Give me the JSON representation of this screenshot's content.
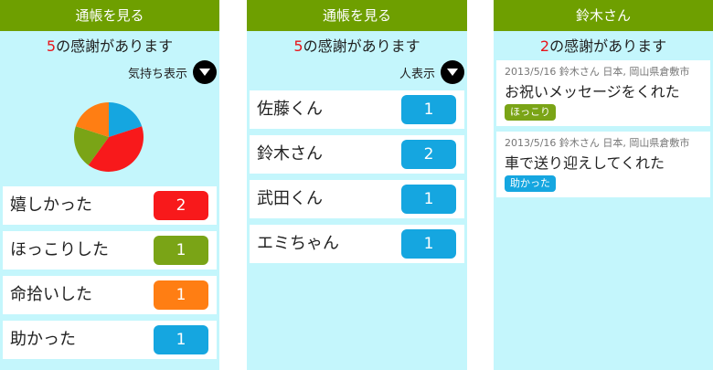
{
  "panel1": {
    "header": "通帳を見る",
    "count": "5",
    "count_suffix": "の感謝があります",
    "toggle_label": "気持ち表示",
    "pie": {
      "slices": [
        {
          "label": "嬉しかった",
          "value": 2,
          "color": "#f8191b"
        },
        {
          "label": "ほっこりした",
          "value": 1,
          "color": "#7aa416"
        },
        {
          "label": "命拾いした",
          "value": 1,
          "color": "#ff7e13"
        },
        {
          "label": "助かった",
          "value": 1,
          "color": "#15a6e0"
        }
      ]
    },
    "rows": [
      {
        "label": "嬉しかった",
        "count": "2",
        "color": "red"
      },
      {
        "label": "ほっこりした",
        "count": "1",
        "color": "green"
      },
      {
        "label": "命拾いした",
        "count": "1",
        "color": "orange"
      },
      {
        "label": "助かった",
        "count": "1",
        "color": "blue"
      }
    ]
  },
  "panel2": {
    "header": "通帳を見る",
    "count": "5",
    "count_suffix": "の感謝があります",
    "toggle_label": "人表示",
    "rows": [
      {
        "label": "佐藤くん",
        "count": "1"
      },
      {
        "label": "鈴木さん",
        "count": "2"
      },
      {
        "label": "武田くん",
        "count": "1"
      },
      {
        "label": "エミちゃん",
        "count": "1"
      }
    ]
  },
  "panel3": {
    "header": "鈴木さん",
    "count": "2",
    "count_suffix": "の感謝があります",
    "cards": [
      {
        "meta": "2013/5/16 鈴木さん 日本, 岡山県倉敷市",
        "message": "お祝いメッセージをくれた",
        "tag": "ほっこり",
        "tag_color": "green"
      },
      {
        "meta": "2013/5/16 鈴木さん 日本, 岡山県倉敷市",
        "message": "車で送り迎えしてくれた",
        "tag": "助かった",
        "tag_color": "blue"
      }
    ]
  }
}
